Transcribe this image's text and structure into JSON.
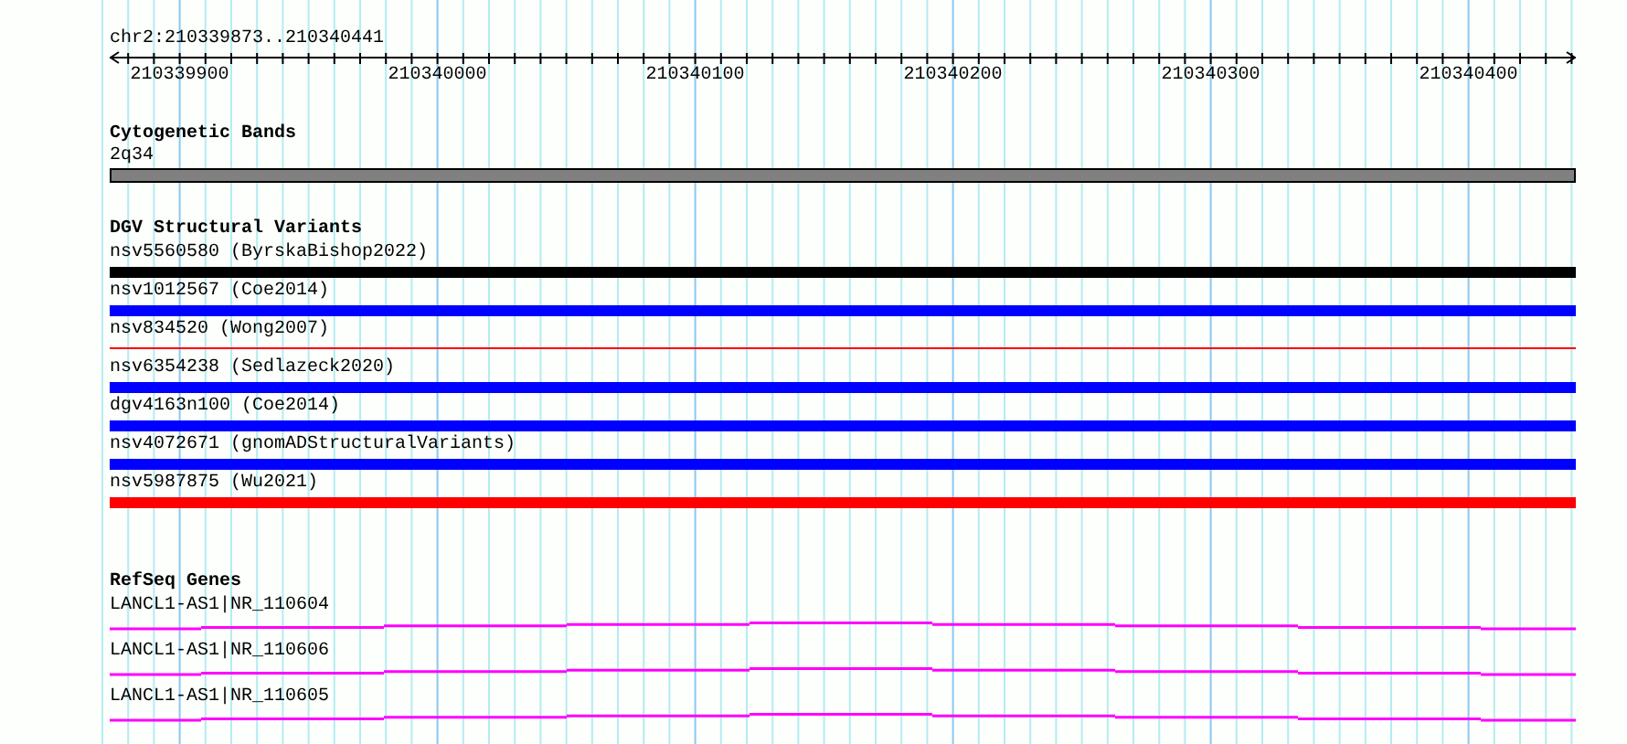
{
  "ruler": {
    "location": "chr2:210339873..210340441",
    "tick_labels": [
      "210339900",
      "210340000",
      "210340100",
      "210340200",
      "210340300",
      "210340400"
    ]
  },
  "tracks": [
    {
      "title": "Cytogenetic Bands",
      "features": [
        {
          "label": "2q34",
          "kind": "band",
          "color": "#808080"
        }
      ]
    },
    {
      "title": "DGV Structural Variants",
      "features": [
        {
          "label": "nsv5560580 (ByrskaBishop2022)",
          "kind": "bar",
          "color": "#000000"
        },
        {
          "label": "nsv1012567 (Coe2014)",
          "kind": "bar",
          "color": "#0000ff"
        },
        {
          "label": "nsv834520 (Wong2007)",
          "kind": "line",
          "color": "#ff0000"
        },
        {
          "label": "nsv6354238 (Sedlazeck2020)",
          "kind": "bar",
          "color": "#0000ff"
        },
        {
          "label": "dgv4163n100 (Coe2014)",
          "kind": "bar",
          "color": "#0000ff"
        },
        {
          "label": "nsv4072671 (gnomADStructuralVariants)",
          "kind": "bar",
          "color": "#0000ff"
        },
        {
          "label": "nsv5987875 (Wu2021)",
          "kind": "bar",
          "color": "#ff0000"
        }
      ]
    },
    {
      "title": "RefSeq Genes",
      "features": [
        {
          "label": "LANCL1-AS1|NR_110604",
          "kind": "gene",
          "color": "#ff00ff"
        },
        {
          "label": "LANCL1-AS1|NR_110606",
          "kind": "gene",
          "color": "#ff00ff"
        },
        {
          "label": "LANCL1-AS1|NR_110605",
          "kind": "gene",
          "color": "#ff00ff"
        }
      ]
    }
  ]
}
